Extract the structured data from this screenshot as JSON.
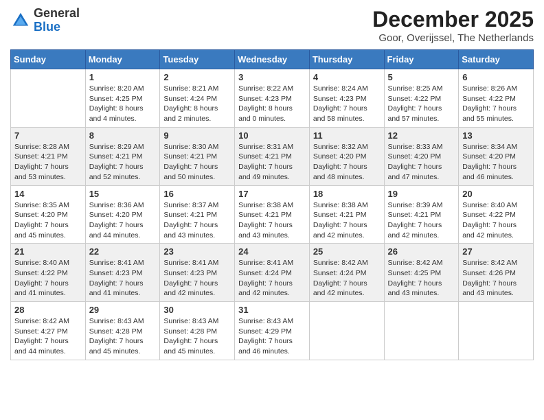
{
  "logo": {
    "general": "General",
    "blue": "Blue"
  },
  "title": "December 2025",
  "subtitle": "Goor, Overijssel, The Netherlands",
  "days_of_week": [
    "Sunday",
    "Monday",
    "Tuesday",
    "Wednesday",
    "Thursday",
    "Friday",
    "Saturday"
  ],
  "weeks": [
    [
      {
        "day": "",
        "info": ""
      },
      {
        "day": "1",
        "info": "Sunrise: 8:20 AM\nSunset: 4:25 PM\nDaylight: 8 hours\nand 4 minutes."
      },
      {
        "day": "2",
        "info": "Sunrise: 8:21 AM\nSunset: 4:24 PM\nDaylight: 8 hours\nand 2 minutes."
      },
      {
        "day": "3",
        "info": "Sunrise: 8:22 AM\nSunset: 4:23 PM\nDaylight: 8 hours\nand 0 minutes."
      },
      {
        "day": "4",
        "info": "Sunrise: 8:24 AM\nSunset: 4:23 PM\nDaylight: 7 hours\nand 58 minutes."
      },
      {
        "day": "5",
        "info": "Sunrise: 8:25 AM\nSunset: 4:22 PM\nDaylight: 7 hours\nand 57 minutes."
      },
      {
        "day": "6",
        "info": "Sunrise: 8:26 AM\nSunset: 4:22 PM\nDaylight: 7 hours\nand 55 minutes."
      }
    ],
    [
      {
        "day": "7",
        "info": "Sunrise: 8:28 AM\nSunset: 4:21 PM\nDaylight: 7 hours\nand 53 minutes."
      },
      {
        "day": "8",
        "info": "Sunrise: 8:29 AM\nSunset: 4:21 PM\nDaylight: 7 hours\nand 52 minutes."
      },
      {
        "day": "9",
        "info": "Sunrise: 8:30 AM\nSunset: 4:21 PM\nDaylight: 7 hours\nand 50 minutes."
      },
      {
        "day": "10",
        "info": "Sunrise: 8:31 AM\nSunset: 4:21 PM\nDaylight: 7 hours\nand 49 minutes."
      },
      {
        "day": "11",
        "info": "Sunrise: 8:32 AM\nSunset: 4:20 PM\nDaylight: 7 hours\nand 48 minutes."
      },
      {
        "day": "12",
        "info": "Sunrise: 8:33 AM\nSunset: 4:20 PM\nDaylight: 7 hours\nand 47 minutes."
      },
      {
        "day": "13",
        "info": "Sunrise: 8:34 AM\nSunset: 4:20 PM\nDaylight: 7 hours\nand 46 minutes."
      }
    ],
    [
      {
        "day": "14",
        "info": "Sunrise: 8:35 AM\nSunset: 4:20 PM\nDaylight: 7 hours\nand 45 minutes."
      },
      {
        "day": "15",
        "info": "Sunrise: 8:36 AM\nSunset: 4:20 PM\nDaylight: 7 hours\nand 44 minutes."
      },
      {
        "day": "16",
        "info": "Sunrise: 8:37 AM\nSunset: 4:21 PM\nDaylight: 7 hours\nand 43 minutes."
      },
      {
        "day": "17",
        "info": "Sunrise: 8:38 AM\nSunset: 4:21 PM\nDaylight: 7 hours\nand 43 minutes."
      },
      {
        "day": "18",
        "info": "Sunrise: 8:38 AM\nSunset: 4:21 PM\nDaylight: 7 hours\nand 42 minutes."
      },
      {
        "day": "19",
        "info": "Sunrise: 8:39 AM\nSunset: 4:21 PM\nDaylight: 7 hours\nand 42 minutes."
      },
      {
        "day": "20",
        "info": "Sunrise: 8:40 AM\nSunset: 4:22 PM\nDaylight: 7 hours\nand 42 minutes."
      }
    ],
    [
      {
        "day": "21",
        "info": "Sunrise: 8:40 AM\nSunset: 4:22 PM\nDaylight: 7 hours\nand 41 minutes."
      },
      {
        "day": "22",
        "info": "Sunrise: 8:41 AM\nSunset: 4:23 PM\nDaylight: 7 hours\nand 41 minutes."
      },
      {
        "day": "23",
        "info": "Sunrise: 8:41 AM\nSunset: 4:23 PM\nDaylight: 7 hours\nand 42 minutes."
      },
      {
        "day": "24",
        "info": "Sunrise: 8:41 AM\nSunset: 4:24 PM\nDaylight: 7 hours\nand 42 minutes."
      },
      {
        "day": "25",
        "info": "Sunrise: 8:42 AM\nSunset: 4:24 PM\nDaylight: 7 hours\nand 42 minutes."
      },
      {
        "day": "26",
        "info": "Sunrise: 8:42 AM\nSunset: 4:25 PM\nDaylight: 7 hours\nand 43 minutes."
      },
      {
        "day": "27",
        "info": "Sunrise: 8:42 AM\nSunset: 4:26 PM\nDaylight: 7 hours\nand 43 minutes."
      }
    ],
    [
      {
        "day": "28",
        "info": "Sunrise: 8:42 AM\nSunset: 4:27 PM\nDaylight: 7 hours\nand 44 minutes."
      },
      {
        "day": "29",
        "info": "Sunrise: 8:43 AM\nSunset: 4:28 PM\nDaylight: 7 hours\nand 45 minutes."
      },
      {
        "day": "30",
        "info": "Sunrise: 8:43 AM\nSunset: 4:28 PM\nDaylight: 7 hours\nand 45 minutes."
      },
      {
        "day": "31",
        "info": "Sunrise: 8:43 AM\nSunset: 4:29 PM\nDaylight: 7 hours\nand 46 minutes."
      },
      {
        "day": "",
        "info": ""
      },
      {
        "day": "",
        "info": ""
      },
      {
        "day": "",
        "info": ""
      }
    ]
  ]
}
